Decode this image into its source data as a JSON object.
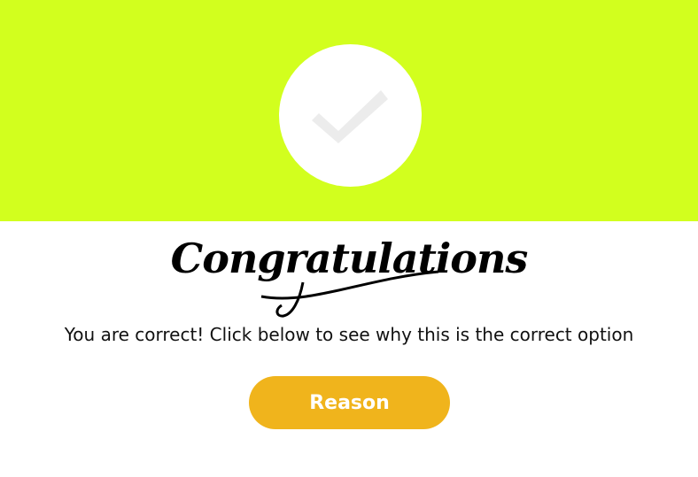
{
  "colors": {
    "banner": "#d2ff1e",
    "check_circle": "#ffffff",
    "checkmark": "#ececec",
    "button": "#f0b41c",
    "button_text": "#ffffff"
  },
  "banner": {
    "icon": "checkmark-icon"
  },
  "result": {
    "congrats_text": "Congratulations",
    "message": "You are correct! Click below to see why this is the correct option"
  },
  "reason_button": {
    "label": "Reason"
  }
}
